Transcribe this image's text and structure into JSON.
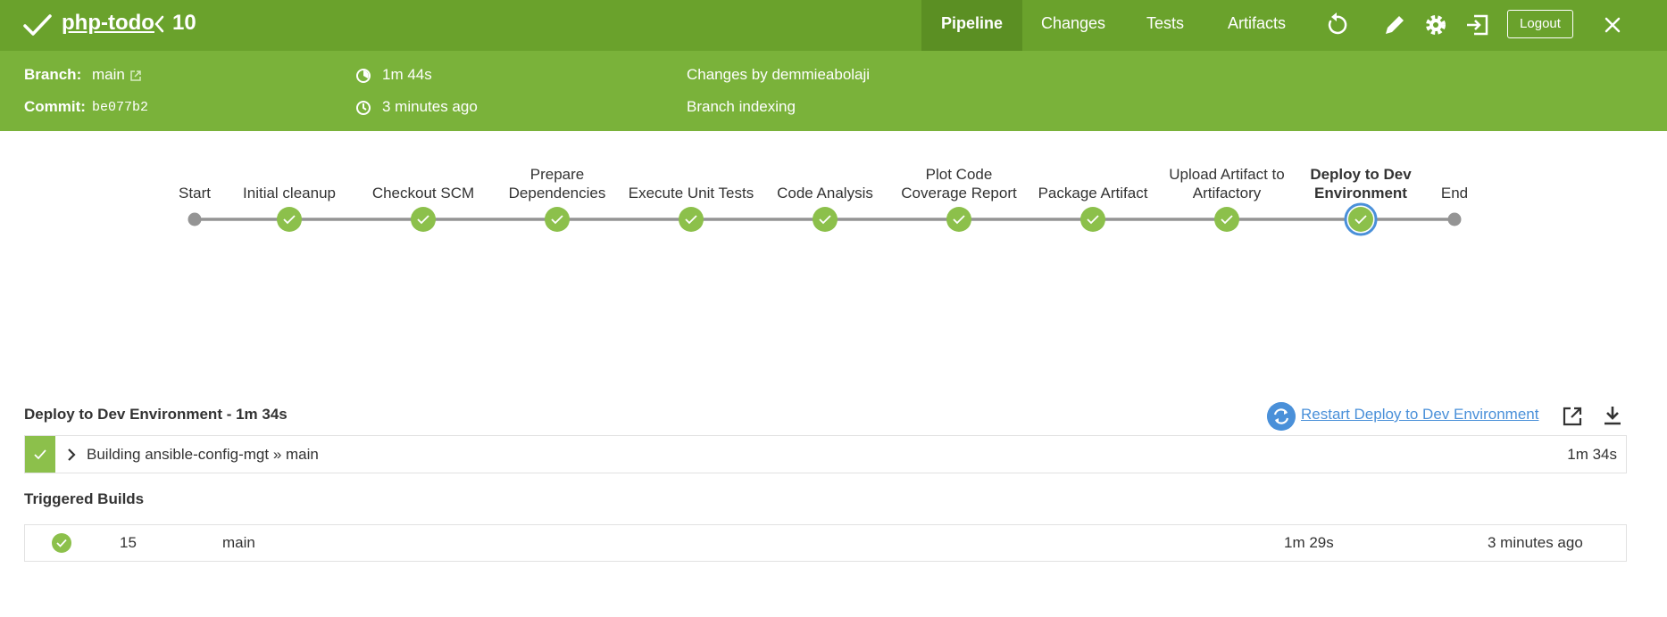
{
  "header": {
    "job_name": "php-todo",
    "run_number": "10",
    "tabs": [
      {
        "label": "Pipeline"
      },
      {
        "label": "Changes"
      },
      {
        "label": "Tests"
      },
      {
        "label": "Artifacts"
      }
    ],
    "logout_label": "Logout"
  },
  "info": {
    "branch_label": "Branch:",
    "branch_value": "main",
    "commit_label": "Commit:",
    "commit_value": "be077b2",
    "duration": "1m 44s",
    "time_ago": "3 minutes ago",
    "changes_by": "Changes by demmieabolaji",
    "cause": "Branch indexing"
  },
  "pipeline": {
    "stages": [
      {
        "label": "Start",
        "status": "none"
      },
      {
        "label": "Initial cleanup",
        "status": "success"
      },
      {
        "label": "Checkout SCM",
        "status": "success"
      },
      {
        "label": "Prepare Dependencies",
        "status": "success"
      },
      {
        "label": "Execute Unit Tests",
        "status": "success"
      },
      {
        "label": "Code Analysis",
        "status": "success"
      },
      {
        "label": "Plot Code Coverage Report",
        "status": "success"
      },
      {
        "label": "Package Artifact",
        "status": "success"
      },
      {
        "label": "Upload Artifact to Artifactory",
        "status": "success"
      },
      {
        "label": "Deploy to Dev Environment",
        "status": "success",
        "selected": true
      },
      {
        "label": "End",
        "status": "none"
      }
    ],
    "colors": {
      "success": "#8cc04b",
      "line": "#949494",
      "selected_ring": "#4a90d9"
    }
  },
  "step": {
    "title": "Deploy to Dev Environment - 1m 34s",
    "restart_label": "Restart Deploy to Dev Environment",
    "log": {
      "title": "Building ansible-config-mgt » main",
      "duration": "1m 34s"
    }
  },
  "triggered": {
    "heading": "Triggered Builds",
    "rows": [
      {
        "number": "15",
        "branch": "main",
        "duration": "1m 29s",
        "when": "3 minutes ago"
      }
    ]
  }
}
